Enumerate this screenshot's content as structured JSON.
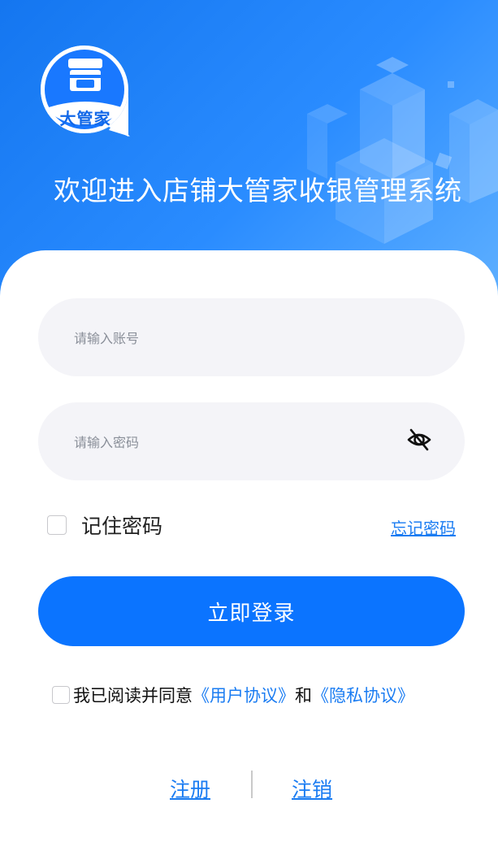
{
  "brand": {
    "logo_text": "大管家"
  },
  "header": {
    "welcome": "欢迎进入店铺大管家收银管理系统"
  },
  "login": {
    "account_placeholder": "请输入账号",
    "password_placeholder": "请输入密码",
    "remember_label": "记住密码",
    "forgot_label": "忘记密码",
    "submit_label": "立即登录"
  },
  "agreement": {
    "prefix": "我已阅读并同意",
    "user_agreement": "《用户协议》",
    "and": "和",
    "privacy_agreement": "《隐私协议》"
  },
  "footer": {
    "register_label": "注册",
    "cancel_label": "注销"
  },
  "colors": {
    "primary": "#0b74ff",
    "link": "#1a7cf2",
    "field_bg": "#f4f4f8"
  }
}
